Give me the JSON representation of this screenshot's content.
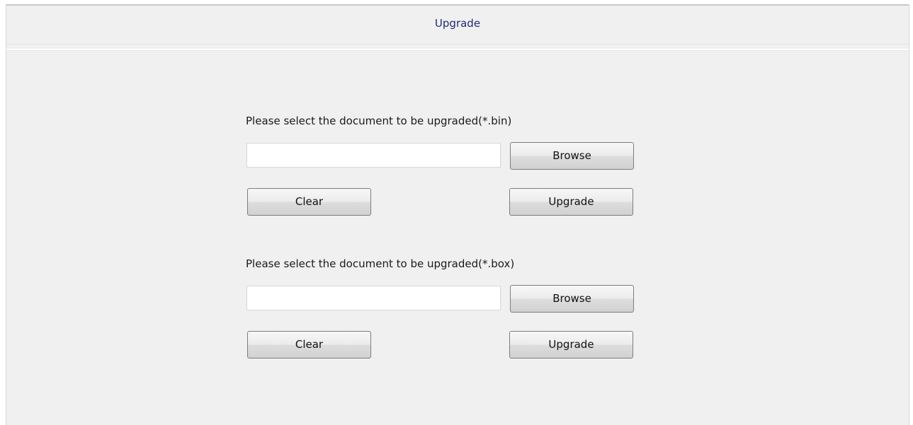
{
  "header": {
    "title": "Upgrade"
  },
  "sections": [
    {
      "label": "Please select the document to be upgraded(*.bin)",
      "file_value": "",
      "browse_label": "Browse",
      "clear_label": "Clear",
      "upgrade_label": "Upgrade"
    },
    {
      "label": "Please select the document to be upgraded(*.box)",
      "file_value": "",
      "browse_label": "Browse",
      "clear_label": "Clear",
      "upgrade_label": "Upgrade"
    }
  ],
  "colors": {
    "title_text": "#1f2a78",
    "panel_background": "#f0f0f0",
    "input_background": "#ffffff"
  }
}
